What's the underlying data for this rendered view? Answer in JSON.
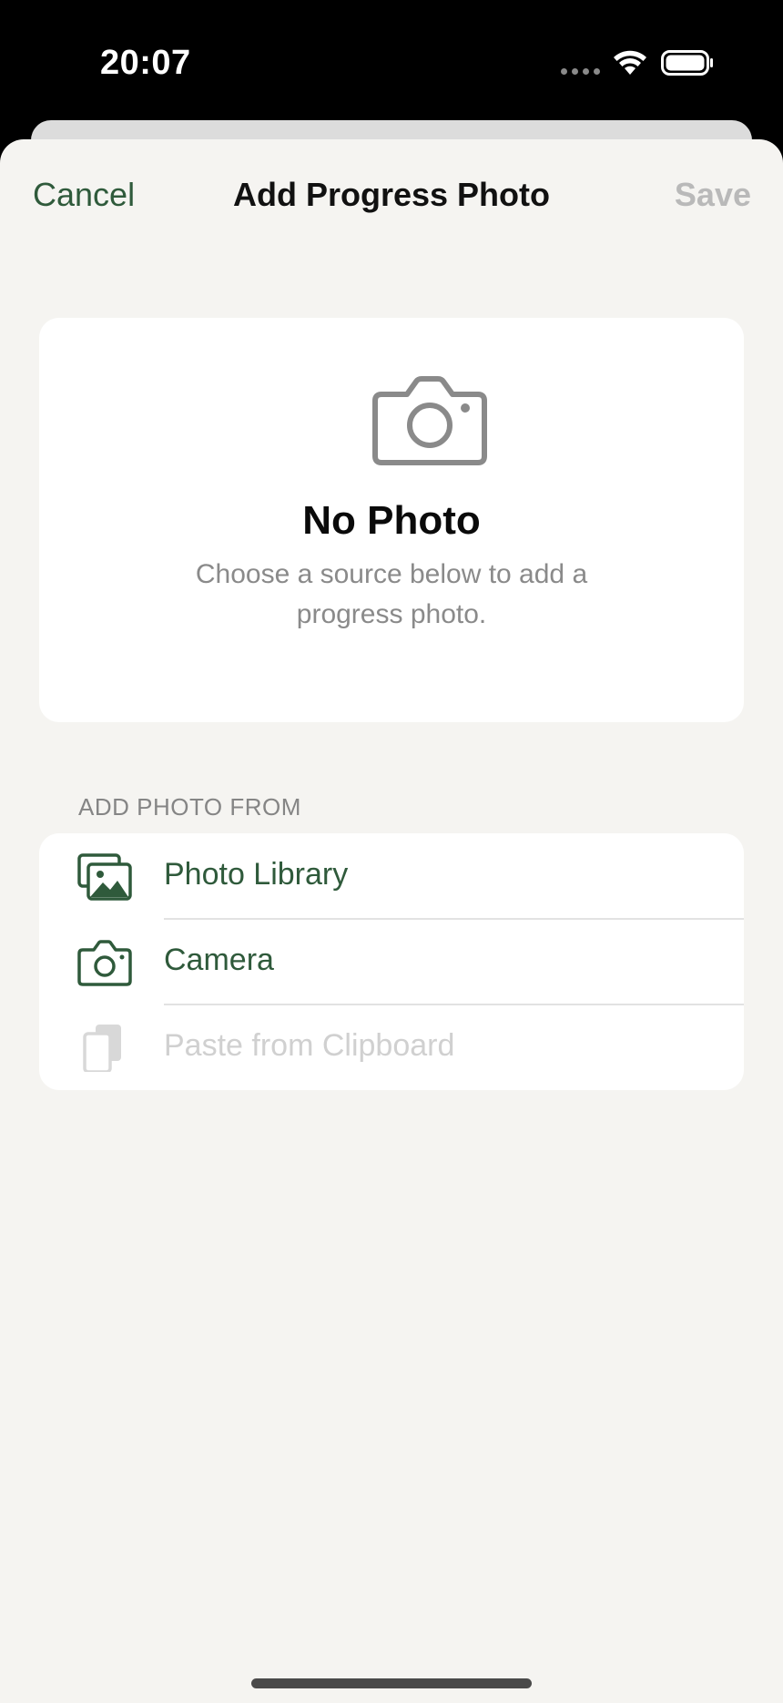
{
  "status_bar": {
    "time": "20:07"
  },
  "nav": {
    "cancel_label": "Cancel",
    "title": "Add Progress Photo",
    "save_label": "Save",
    "save_enabled": false
  },
  "placeholder": {
    "icon": "camera-icon",
    "title": "No Photo",
    "subtitle": "Choose a source below to add a progress photo."
  },
  "add_from": {
    "header": "ADD PHOTO FROM",
    "items": [
      {
        "label": "Photo Library",
        "icon": "photo-library-icon",
        "enabled": true
      },
      {
        "label": "Camera",
        "icon": "camera-icon",
        "enabled": true
      },
      {
        "label": "Paste from Clipboard",
        "icon": "clipboard-icon",
        "enabled": false
      }
    ]
  },
  "colors": {
    "accent": "#2f5a3b",
    "background": "#f5f4f1",
    "card": "#ffffff",
    "secondary_text": "#8a8a8a",
    "disabled_text": "#d0d0d0"
  }
}
